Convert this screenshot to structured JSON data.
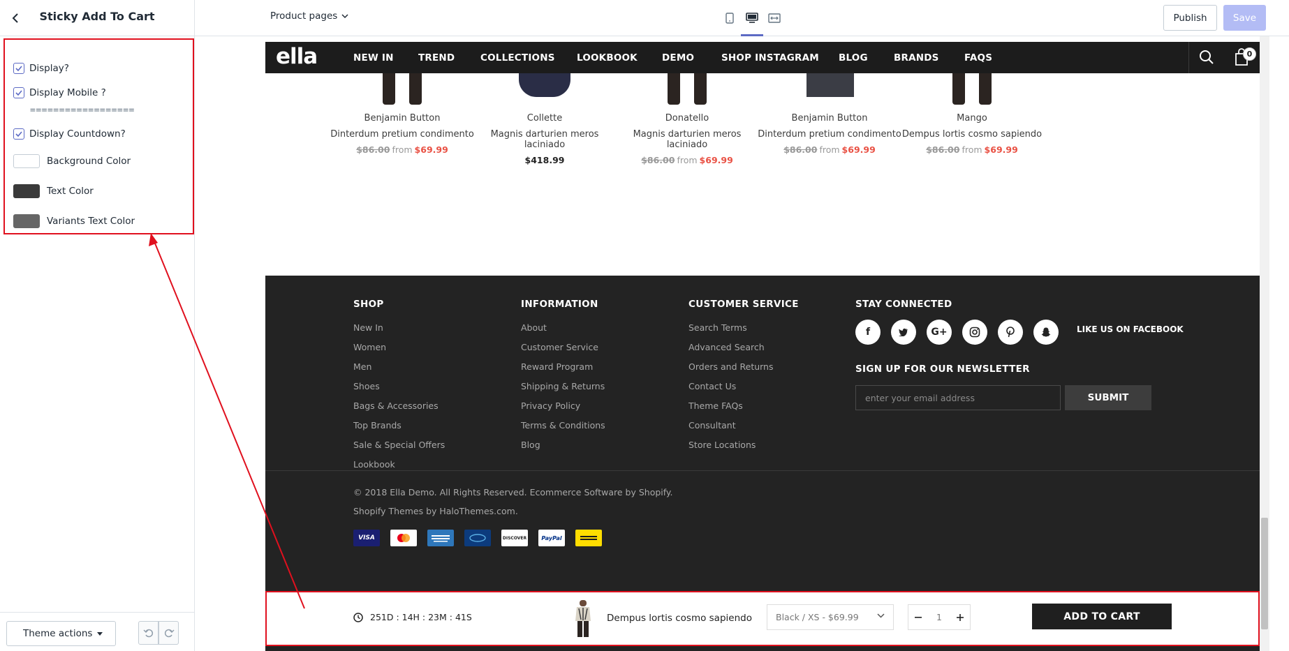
{
  "sidebar": {
    "title": "Sticky Add To Cart",
    "checks": [
      {
        "label": "Display?",
        "checked": true
      },
      {
        "label": "Display Mobile ?",
        "checked": true
      }
    ],
    "separator": "==================",
    "countdown_check": {
      "label": "Display Countdown?",
      "checked": true
    },
    "colors": [
      {
        "label": "Background Color",
        "value": "#ffffff"
      },
      {
        "label": "Text Color",
        "value": "#3a3a3a"
      },
      {
        "label": "Variants Text Color",
        "value": "#666666"
      }
    ],
    "theme_actions": "Theme actions"
  },
  "topbar": {
    "pages_select": "Product pages",
    "publish": "Publish",
    "save": "Save"
  },
  "site": {
    "logo": "ella",
    "nav": [
      "NEW IN",
      "TREND",
      "COLLECTIONS",
      "LOOKBOOK",
      "DEMO",
      "SHOP INSTAGRAM",
      "BLOG",
      "BRANDS",
      "FAQS"
    ],
    "cart_count": "0"
  },
  "products": [
    {
      "vendor": "Benjamin Button",
      "name": "Dinterdum pretium condimento",
      "old_price": "$86.00",
      "from": "from",
      "price": "$69.99"
    },
    {
      "vendor": "Collette",
      "name": "Magnis darturien meros laciniado",
      "price": "$418.99"
    },
    {
      "vendor": "Donatello",
      "name": "Magnis darturien meros laciniado",
      "old_price": "$86.00",
      "from": "from",
      "price": "$69.99"
    },
    {
      "vendor": "Benjamin Button",
      "name": "Dinterdum pretium condimento",
      "old_price": "$86.00",
      "from": "from",
      "price": "$69.99"
    },
    {
      "vendor": "Mango",
      "name": "Dempus lortis cosmo sapiendo",
      "old_price": "$86.00",
      "from": "from",
      "price": "$69.99"
    }
  ],
  "footer": {
    "columns": [
      {
        "title": "SHOP",
        "links": [
          "New In",
          "Women",
          "Men",
          "Shoes",
          "Bags & Accessories",
          "Top Brands",
          "Sale & Special Offers",
          "Lookbook"
        ]
      },
      {
        "title": "INFORMATION",
        "links": [
          "About",
          "Customer Service",
          "Reward Program",
          "Shipping & Returns",
          "Privacy Policy",
          "Terms & Conditions",
          "Blog"
        ]
      },
      {
        "title": "CUSTOMER SERVICE",
        "links": [
          "Search Terms",
          "Advanced Search",
          "Orders and Returns",
          "Contact Us",
          "Theme FAQs",
          "Consultant",
          "Store Locations"
        ]
      }
    ],
    "stay_connected": "STAY CONNECTED",
    "like_us": "LIKE US ON FACEBOOK",
    "newsletter_title": "SIGN UP FOR OUR NEWSLETTER",
    "newsletter_placeholder": "enter your email address",
    "submit": "SUBMIT",
    "copyright": "© 2018 Ella Demo. All Rights Reserved. Ecommerce Software by Shopify.",
    "themes_by": "Shopify Themes by HaloThemes.com.",
    "payments": [
      "VISA",
      "",
      "",
      "",
      "DISCOVER",
      "PayPal",
      ""
    ]
  },
  "sticky": {
    "countdown": "251D : 14H : 23M : 41S",
    "product_name": "Dempus lortis cosmo sapiendo",
    "variant": "Black / XS - $69.99",
    "quantity": "1",
    "add_to_cart": "ADD TO CART"
  }
}
